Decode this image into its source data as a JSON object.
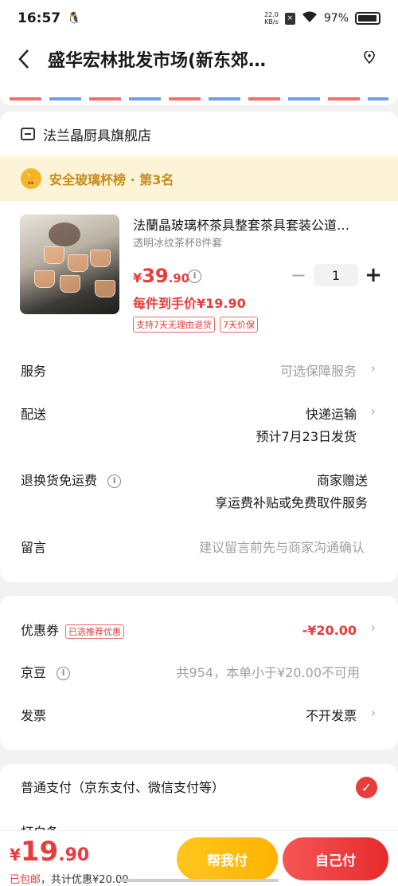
{
  "status_bar": {
    "time": "16:57",
    "netspeed_value": "22.0",
    "netspeed_unit": "KB/s",
    "battery": "97%"
  },
  "header": {
    "title": "盛华宏林批发市场(新东郊…",
    "back_icon": "back-arrow-icon",
    "location_icon": "location-icon"
  },
  "store": {
    "name": "法兰晶厨具旗舰店",
    "rank_text": "安全玻璃杯榜 · 第3名",
    "product": {
      "title": "法蘭晶玻璃杯茶具整套茶具套装公道…",
      "variant": "透明冰纹茶杯8件套",
      "price_yen": "¥",
      "price_int": "39",
      "price_dec": ".90",
      "quantity": "1",
      "unit_price": "每件到手价¥19.90",
      "tags": [
        "支持7天无理由退货",
        "7天价保"
      ]
    },
    "rows": {
      "service_label": "服务",
      "service_value": "可选保障服务",
      "delivery_label": "配送",
      "delivery_value": "快递运输",
      "delivery_date": "预计7月23日发货",
      "return_label": "退换货免运费",
      "return_value": "商家赠送",
      "return_sub": "享运费补贴或免费取件服务",
      "note_label": "留言",
      "note_placeholder": "建议留言前先与商家沟通确认"
    }
  },
  "coupon": {
    "coupon_label": "优惠券",
    "coupon_tag": "已选推荐优惠",
    "coupon_value": "-¥20.00",
    "jd_label": "京豆",
    "jd_value": "共954，本单小于¥20.00不可用",
    "invoice_label": "发票",
    "invoice_value": "不开发票"
  },
  "payment": {
    "normal_pay": "普通支付（京东支付、微信支付等）",
    "next_label": "打白条"
  },
  "bottom": {
    "total_yen": "¥",
    "total_int": "19",
    "total_dec": ".90",
    "shipping_free": "已包邮",
    "discount_text": "，共计优惠",
    "discount_amount": "¥20.00",
    "help_pay": "帮我付",
    "submit": "自己付"
  },
  "colors": {
    "accent": "#e93c3c",
    "gold": "#ffb300",
    "rank_bg": "#fdf3d6"
  }
}
